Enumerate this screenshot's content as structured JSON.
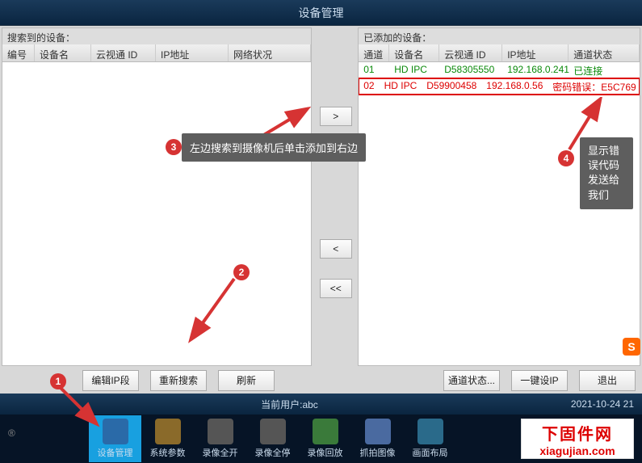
{
  "title": "设备管理",
  "left": {
    "label": "搜索到的设备：",
    "headers": [
      "编号",
      "设备名",
      "云视通 ID",
      "IP地址",
      "网络状况"
    ]
  },
  "right": {
    "label": "已添加的设备：",
    "headers": [
      "通道",
      "设备名",
      "云视通 ID",
      "IP地址",
      "通道状态"
    ],
    "rows": [
      {
        "ch": "01",
        "name": "HD IPC",
        "id": "D58305550",
        "ip": "192.168.0.241",
        "status": "已连接",
        "cls": "green"
      },
      {
        "ch": "02",
        "name": "HD IPC",
        "id": "D59900458",
        "ip": "192.168.0.56",
        "status": "密码错误：E5C769",
        "cls": "red hl"
      }
    ]
  },
  "midbtns": {
    "add": ">",
    "remove": "<",
    "remove_all": "<<"
  },
  "buttons": {
    "editip": "编辑IP段",
    "research": "重新搜索",
    "refresh": "刷新",
    "chstatus": "通道状态...",
    "oneset": "一键设IP",
    "exit": "退出"
  },
  "status": {
    "user_label": "当前用户:abc",
    "time": "2021-10-24  21"
  },
  "taskbar": [
    {
      "label": "设备管理",
      "active": true
    },
    {
      "label": "系统参数"
    },
    {
      "label": "录像全开"
    },
    {
      "label": "录像全停"
    },
    {
      "label": "录像回放"
    },
    {
      "label": "抓拍图像"
    },
    {
      "label": "画面布局"
    }
  ],
  "tips": {
    "tip3": "左边搜索到摄像机后单击添加到右边",
    "tip4": "显示错误代码发送给我们"
  },
  "markers": {
    "1": "1",
    "2": "2",
    "3": "3",
    "4": "4"
  },
  "watermark": {
    "cn": "下固件网",
    "en": "xiagujian.com"
  },
  "badge": "S",
  "copyright": "®"
}
